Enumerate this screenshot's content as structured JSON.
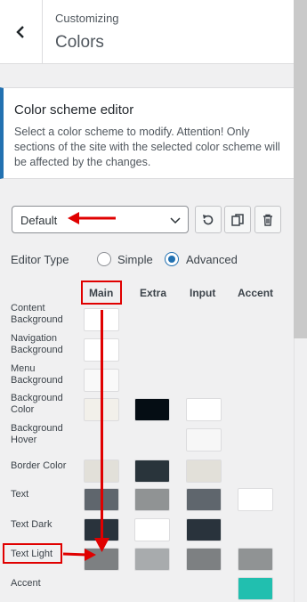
{
  "header": {
    "crumb": "Customizing",
    "title": "Colors"
  },
  "description": {
    "title": "Color scheme editor",
    "text": "Select a color scheme to modify. Attention! Only sections of the site with the selected color scheme will be affected by the changes."
  },
  "scheme_select": {
    "value": "Default"
  },
  "editor_type": {
    "label": "Editor Type",
    "options": [
      "Simple",
      "Advanced"
    ],
    "selected": "Advanced"
  },
  "columns": [
    "Main",
    "Extra",
    "Input",
    "Accent"
  ],
  "rows": [
    {
      "label": "Content Background",
      "colors": [
        "#ffffff",
        null,
        null,
        null
      ]
    },
    {
      "label": "Navigation Background",
      "colors": [
        "#ffffff",
        null,
        null,
        null
      ]
    },
    {
      "label": "Menu Background",
      "colors": [
        "#f9f9f9",
        null,
        null,
        null
      ]
    },
    {
      "label": "Background Color",
      "colors": [
        "#f2f0ea",
        "#050d14",
        "#ffffff",
        null
      ]
    },
    {
      "label": "Background Hover",
      "colors": [
        null,
        null,
        "#f7f7f7",
        null
      ]
    },
    {
      "label": "Border Color",
      "colors": [
        "#e2e0d9",
        "#29343b",
        "#e2e0d9",
        null
      ]
    },
    {
      "label": "Text",
      "colors": [
        "#5f666d",
        "#909394",
        "#5f666d",
        "#ffffff"
      ]
    },
    {
      "label": "Text Dark",
      "colors": [
        "#29333c",
        "#ffffff",
        "#29333c",
        null
      ]
    },
    {
      "label": "Text Light",
      "colors": [
        "#7d8082",
        "#a8abad",
        "#7d8082",
        "#909394"
      ]
    },
    {
      "label": "Accent",
      "colors": [
        null,
        null,
        null,
        "#21bfaf"
      ]
    }
  ],
  "annotation_color": "#e00000"
}
